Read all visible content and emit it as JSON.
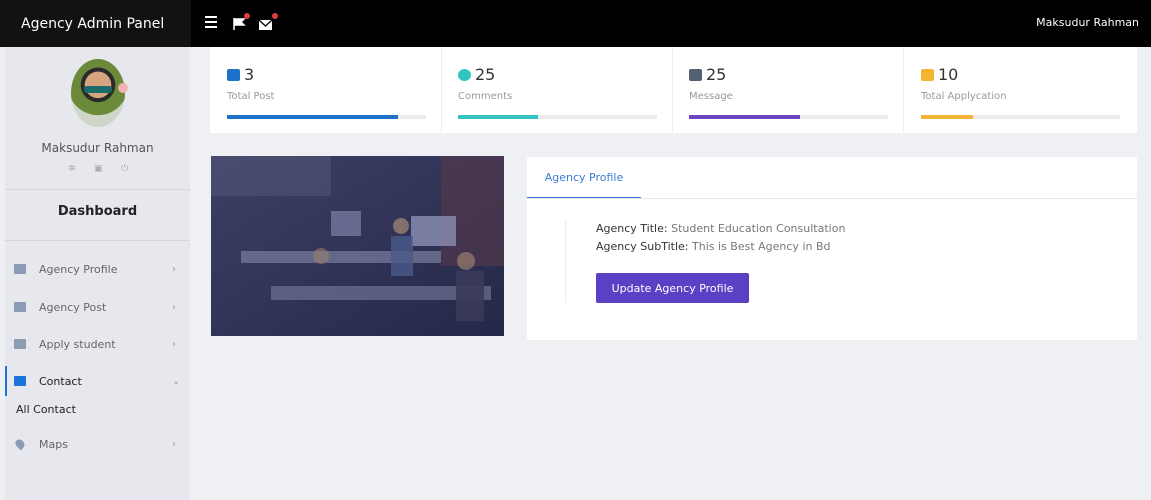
{
  "header": {
    "brand": "Agency Admin Panel",
    "user_name": "Maksudur Rahman",
    "icons": [
      "menu-icon",
      "flag-notification-icon",
      "mail-notification-icon"
    ]
  },
  "sidebar": {
    "profile_name": "Maksudur Rahman",
    "profile_icons": [
      "gear-icon",
      "envelope-icon",
      "power-icon"
    ],
    "section_title": "Dashboard",
    "items": [
      {
        "label": "Agency Profile",
        "icon": "list-icon"
      },
      {
        "label": "Agency Post",
        "icon": "document-icon"
      },
      {
        "label": "Apply student",
        "icon": "chat-icon"
      },
      {
        "label": "Contact",
        "icon": "chat-icon",
        "expanded": true,
        "subitems": [
          {
            "label": "All Contact"
          }
        ]
      },
      {
        "label": "Maps",
        "icon": "map-pin-icon"
      }
    ]
  },
  "stats": [
    {
      "value": "3",
      "label": "Total Post",
      "icon": "clipboard-icon",
      "color": "#1e73c8",
      "progress": 0.86
    },
    {
      "value": "25",
      "label": "Comments",
      "icon": "info-icon",
      "color": "#34c3c1",
      "progress": 0.4
    },
    {
      "value": "25",
      "label": "Message",
      "icon": "chat-icon",
      "color": "#6a46c2",
      "progress": 0.56
    },
    {
      "value": "10",
      "label": "Total Applycation",
      "icon": "layers-icon",
      "color": "#f2b432",
      "progress": 0.26
    }
  ],
  "profile": {
    "tab_label": "Agency Profile",
    "title_label": "Agency Title:",
    "title_value": " Student Education Consultation",
    "subtitle_label": "Agency SubTitle:",
    "subtitle_value": " This is Best Agency in Bd",
    "button_label": "Update Agency Profile"
  },
  "colors": {
    "topbar": "#000000",
    "accent": "#1c74d9",
    "button": "#5b3fc4"
  }
}
